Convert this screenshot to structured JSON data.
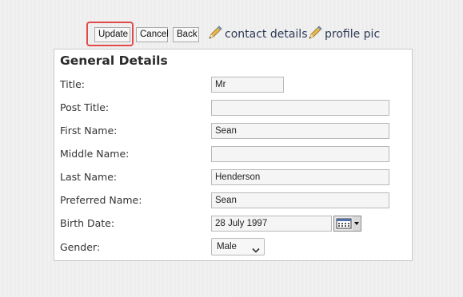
{
  "toolbar": {
    "update_label": "Update",
    "cancel_label": "Cancel",
    "back_label": "Back",
    "contact_details_label": "contact details",
    "profile_pic_label": "profile pic",
    "contact_details_icon": "pencil-icon",
    "profile_pic_icon": "pencil-icon",
    "highlight_color": "#e24a4a"
  },
  "panel": {
    "title": "General Details",
    "fields": [
      {
        "label": "Title:",
        "value": ""
      },
      {
        "label": "Post Title:",
        "value": ""
      },
      {
        "label": "First Name:",
        "value": "Sean"
      },
      {
        "label": "Middle Name:",
        "value": ""
      },
      {
        "label": "Last Name:",
        "value": "Henderson"
      },
      {
        "label": "Preferred Name:",
        "value": "Sean"
      },
      {
        "label": "Birth Date:",
        "value": "28 July 1997"
      },
      {
        "label": "Gender:",
        "value": "Male"
      }
    ],
    "title_value": "Mr",
    "calendar_icon": "calendar-icon",
    "dropdown_icon": "chevron-down-icon"
  }
}
